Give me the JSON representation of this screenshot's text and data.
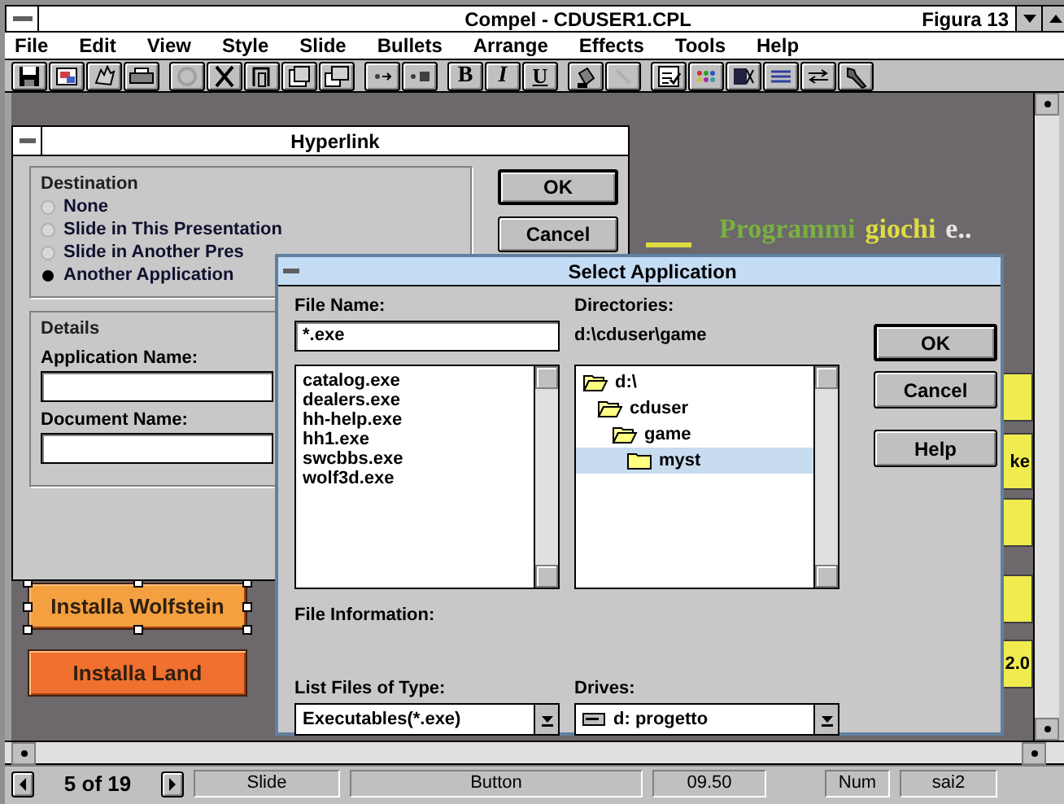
{
  "window": {
    "title": "Compel - CDUSER1.CPL",
    "caption_right": "Figura 13"
  },
  "menu": [
    "File",
    "Edit",
    "View",
    "Style",
    "Slide",
    "Bullets",
    "Arrange",
    "Effects",
    "Tools",
    "Help"
  ],
  "format_buttons": [
    "B",
    "I",
    "U"
  ],
  "hyperlink": {
    "title": "Hyperlink",
    "destination_label": "Destination",
    "options": [
      {
        "label": "None",
        "selected": false
      },
      {
        "label": "Slide in This Presentation",
        "selected": false
      },
      {
        "label": "Slide in Another Pres",
        "selected": false
      },
      {
        "label": "Another Application",
        "selected": true
      }
    ],
    "details_label": "Details",
    "fields": [
      {
        "label": "Application Name:"
      },
      {
        "label": "Document Name:"
      }
    ],
    "buttons": [
      "OK",
      "Cancel"
    ]
  },
  "slide": {
    "title_parts": [
      {
        "text": "Programmi",
        "color": "#7ab040"
      },
      {
        "text": "giochi",
        "color": "#e0dc40"
      },
      {
        "text": "e..",
        "color": "#e8e8e0"
      }
    ],
    "buttons": [
      {
        "label": "Installa Wolfstein",
        "selected": true,
        "color": "#f4a040"
      },
      {
        "label": "Installa Land",
        "selected": false,
        "color": "#f07030"
      }
    ],
    "side_boxes": [
      {
        "kind": "blank"
      },
      {
        "kind": "text",
        "label": "ke"
      },
      {
        "kind": "blank"
      },
      {
        "kind": "blank"
      },
      {
        "kind": "text",
        "label": "2.0"
      }
    ]
  },
  "select": {
    "title": "Select Application",
    "file_name_label": "File Name:",
    "file_name": "*.exe",
    "files": [
      "catalog.exe",
      "dealers.exe",
      "hh-help.exe",
      "hh1.exe",
      "swcbbs.exe",
      "wolf3d.exe"
    ],
    "directories_label": "Directories:",
    "path": "d:\\cduser\\game",
    "tree": [
      {
        "label": "d:\\",
        "open": true,
        "selected": false,
        "children": [
          {
            "label": "cduser",
            "open": true,
            "selected": false,
            "children": [
              {
                "label": "game",
                "open": true,
                "selected": false,
                "children": [
                  {
                    "label": "myst",
                    "open": false,
                    "selected": true
                  }
                ]
              }
            ]
          }
        ]
      }
    ],
    "buttons": [
      "OK",
      "Cancel",
      "Help"
    ],
    "file_info_label": "File Information:",
    "type_label": "List Files of Type:",
    "type_value": "Executables(*.exe)",
    "drives_label": "Drives:",
    "drive_value": "d: progetto"
  },
  "status_bar": {
    "page": "5 of 19",
    "fields": [
      "Slide",
      "Button",
      "09.50",
      "Num",
      "sai2"
    ]
  }
}
